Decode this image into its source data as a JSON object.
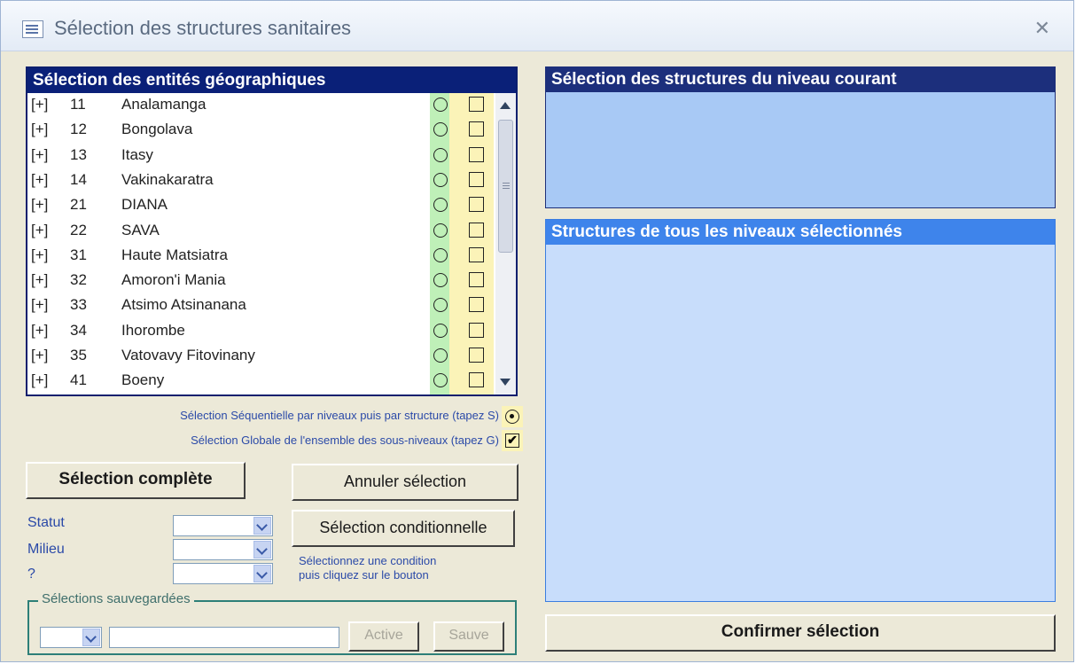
{
  "window": {
    "title": "Sélection des structures sanitaires",
    "close_glyph": "✕"
  },
  "geo": {
    "header": "Sélection des entités géographiques",
    "rows": [
      {
        "exp": "[+]",
        "code": "11",
        "label": "Analamanga"
      },
      {
        "exp": "[+]",
        "code": "12",
        "label": "Bongolava"
      },
      {
        "exp": "[+]",
        "code": "13",
        "label": "Itasy"
      },
      {
        "exp": "[+]",
        "code": "14",
        "label": "Vakinakaratra"
      },
      {
        "exp": "[+]",
        "code": "21",
        "label": "DIANA"
      },
      {
        "exp": "[+]",
        "code": "22",
        "label": "SAVA"
      },
      {
        "exp": "[+]",
        "code": "31",
        "label": "Haute Matsiatra"
      },
      {
        "exp": "[+]",
        "code": "32",
        "label": "Amoron'i Mania"
      },
      {
        "exp": "[+]",
        "code": "33",
        "label": "Atsimo Atsinanana"
      },
      {
        "exp": "[+]",
        "code": "34",
        "label": "Ihorombe"
      },
      {
        "exp": "[+]",
        "code": "35",
        "label": "Vatovavy Fitovinany"
      },
      {
        "exp": "[+]",
        "code": "41",
        "label": "Boeny"
      }
    ]
  },
  "options": {
    "sequential": "Sélection Séquentielle par niveaux puis par structure (tapez S)",
    "global": "Sélection Globale de l'ensemble des sous-niveaux (tapez G)",
    "global_check": "✔"
  },
  "buttons": {
    "complete": "Sélection complète",
    "cancel": "Annuler sélection",
    "conditional": "Sélection conditionnelle",
    "active": "Active",
    "save": "Sauve",
    "confirm": "Confirmer sélection"
  },
  "filters": {
    "statut": "Statut",
    "milieu": "Milieu",
    "other": "?"
  },
  "hint": {
    "line1": "Sélectionnez une condition",
    "line2": "puis cliquez sur le bouton"
  },
  "saved": {
    "legend": "Sélections sauvegardées"
  },
  "right": {
    "current_header": "Sélection des structures du niveau courant",
    "all_header": "Structures de tous les niveaux sélectionnés"
  }
}
